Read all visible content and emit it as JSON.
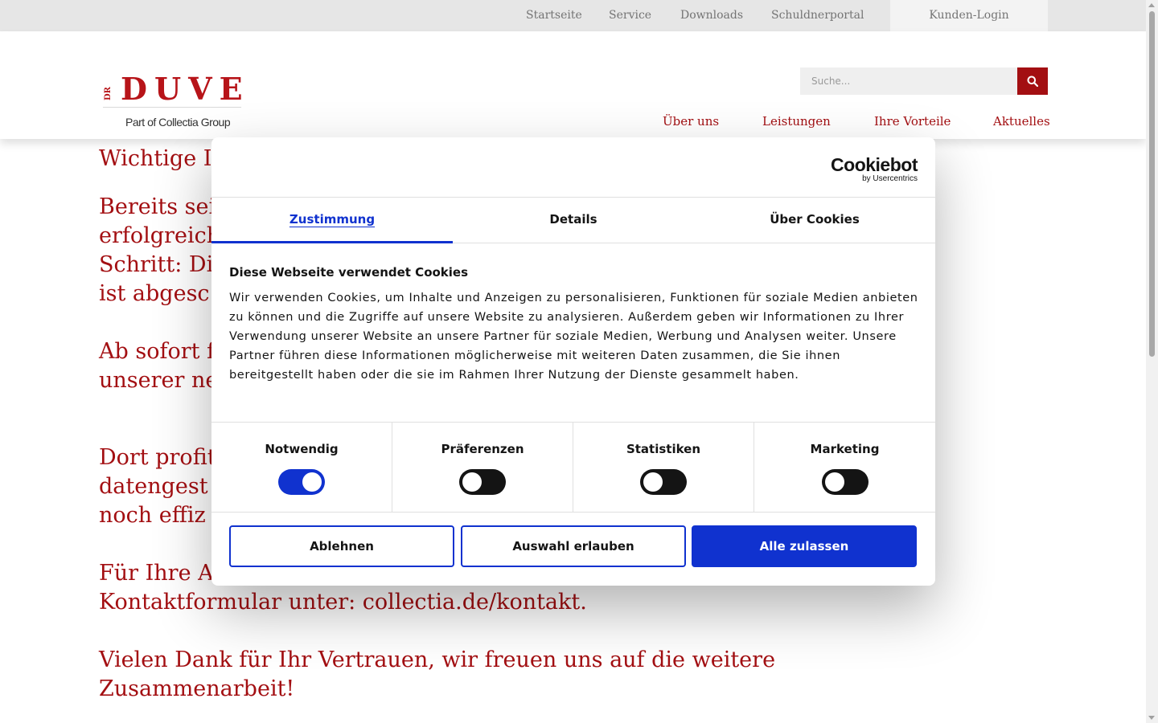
{
  "topbar": {
    "links": [
      "Startseite",
      "Service",
      "Downloads",
      "Schuldnerportal"
    ],
    "login_label": "Kunden-Login"
  },
  "logo": {
    "dr": "DR",
    "name": "DUVE",
    "tagline": "Part of Collectia Group"
  },
  "search": {
    "placeholder": "Suche..."
  },
  "main_nav": [
    "Über uns",
    "Leistungen",
    "Ihre Vorteile",
    "Aktuelles"
  ],
  "content": {
    "heading_visible": "Wichtige I",
    "p1_lines": [
      "Bereits sei",
      "erfolgreich",
      "Schritt: Die",
      "ist abgesc"
    ],
    "p2_lines": [
      "Ab sofort f",
      "unserer ne"
    ],
    "p3_lines": [
      "Dort profit",
      "datengest",
      "noch effiz"
    ],
    "p4_lines": [
      "Für Ihre A",
      "Kontaktformular unter: collectia.de/kontakt."
    ],
    "p5_lines": [
      "Vielen Dank für Ihr Vertrauen, wir freuen uns auf die weitere",
      "Zusammenarbeit!"
    ]
  },
  "cookie_dialog": {
    "brand": "Cookiebot",
    "brand_sub": "by Usercentrics",
    "tabs": [
      "Zustimmung",
      "Details",
      "Über Cookies"
    ],
    "active_tab": "Zustimmung",
    "title": "Diese Webseite verwendet Cookies",
    "text": "Wir verwenden Cookies, um Inhalte und Anzeigen zu personalisieren, Funktionen für soziale Medien anbieten zu können und die Zugriffe auf unsere Website zu analysieren. Außerdem geben wir Informationen zu Ihrer Verwendung unserer Website an unsere Partner für soziale Medien, Werbung und Analysen weiter. Unsere Partner führen diese Informationen möglicherweise mit weiteren Daten zusammen, die Sie ihnen bereitgestellt haben oder die sie im Rahmen Ihrer Nutzung der Dienste gesammelt haben.",
    "categories": [
      {
        "label": "Notwendig",
        "enabled": true
      },
      {
        "label": "Präferenzen",
        "enabled": false
      },
      {
        "label": "Statistiken",
        "enabled": false
      },
      {
        "label": "Marketing",
        "enabled": false
      }
    ],
    "buttons": {
      "reject": "Ablehnen",
      "allow_selection": "Auswahl erlauben",
      "allow_all": "Alle zulassen"
    }
  },
  "colors": {
    "brand_red": "#a30f12",
    "cookiebot_blue": "#1032cf"
  }
}
